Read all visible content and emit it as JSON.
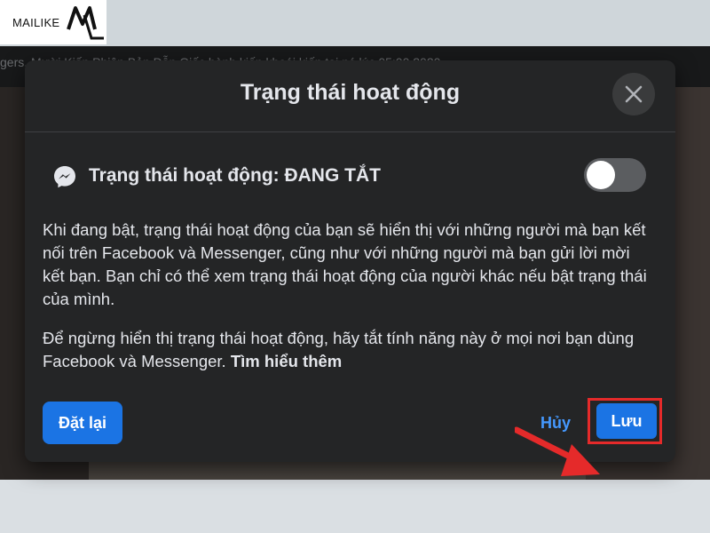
{
  "branding": {
    "text": "MAILIKE"
  },
  "background": {
    "strip_text": "gers. Mười Kiến Phiên Bản Dẫn Giấc hành kiến khoái kiến tai nó                 lúc 05:00 2020"
  },
  "modal": {
    "title": "Trạng thái hoạt động",
    "status_label": "Trạng thái hoạt động: ĐANG TẮT",
    "toggle_on": false,
    "description_1": "Khi đang bật, trạng thái hoạt động của bạn sẽ hiển thị với những người mà bạn kết nối trên Facebook và Messenger, cũng như với những người mà bạn gửi lời mời kết bạn. Bạn chỉ có thể xem trạng thái hoạt động của người khác nếu bật trạng thái của mình.",
    "description_2": "Để ngừng hiển thị trạng thái hoạt động, hãy tắt tính năng này ở mọi nơi bạn dùng Facebook và Messenger.",
    "learn_more": "Tìm hiểu thêm",
    "reset_label": "Đặt lại",
    "cancel_label": "Hủy",
    "save_label": "Lưu"
  },
  "colors": {
    "accent": "#1b74e4",
    "link": "#4599ff",
    "highlight": "#e52a2a",
    "modal_bg": "#242526"
  },
  "icons": [
    "mailike-logo",
    "close-icon",
    "messenger-icon",
    "red-arrow"
  ]
}
